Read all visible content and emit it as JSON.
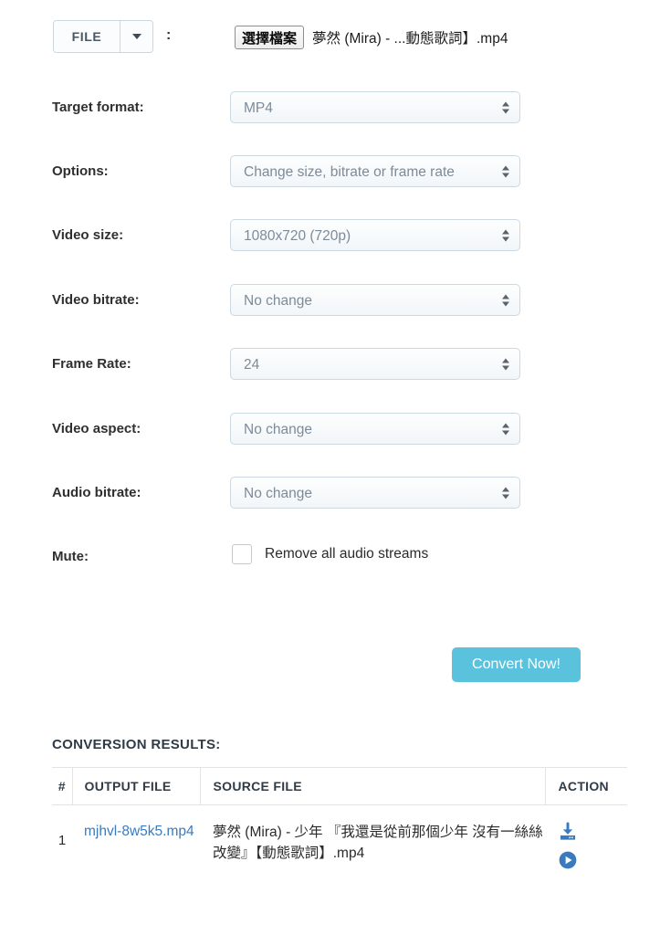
{
  "file_row": {
    "source_button_label": "FILE",
    "caret_icon": "chevron-down-icon",
    "separator": ":",
    "choose_file_label": "選擇檔案",
    "chosen_file_name": "夢然 (Mira) - ...動態歌詞】.mp4"
  },
  "form": {
    "rows": [
      {
        "label": "Target format:",
        "value": "MP4"
      },
      {
        "label": "Options:",
        "value": "Change size, bitrate or frame rate"
      },
      {
        "label": "Video size:",
        "value": "1080x720 (720p)"
      },
      {
        "label": "Video bitrate:",
        "value": "No change"
      },
      {
        "label": "Frame Rate:",
        "value": "24"
      },
      {
        "label": "Video aspect:",
        "value": "No change"
      },
      {
        "label": "Audio bitrate:",
        "value": "No change"
      }
    ],
    "mute": {
      "label": "Mute:",
      "checkbox_label": "Remove all audio streams",
      "checked": false
    }
  },
  "convert": {
    "label": "Convert Now!",
    "color": "#5bc2dd"
  },
  "results": {
    "title": "CONVERSION RESULTS:",
    "columns": [
      "#",
      "OUTPUT FILE",
      "SOURCE FILE",
      "ACTION"
    ],
    "rows": [
      {
        "num": "1",
        "output_file": "mjhvl-8w5k5.mp4",
        "source_file": "夢然 (Mira) - 少年 『我還是從前那個少年 沒有一絲絲改變』【動態歌詞】.mp4",
        "actions": [
          "download-icon",
          "play-icon"
        ]
      }
    ],
    "link_color": "#3a7bbf"
  }
}
